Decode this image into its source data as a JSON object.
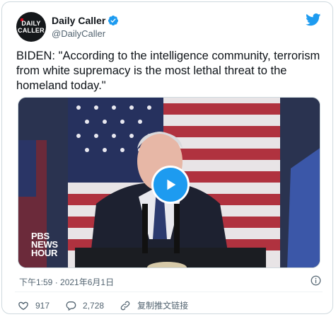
{
  "author": {
    "display_name": "Daily Caller",
    "handle": "@DailyCaller",
    "avatar_line1": "DAILY",
    "avatar_line2": "CALLER"
  },
  "tweet": {
    "text": "BIDEN: \"According to the intelligence community, terrorism from white supremacy is the most lethal threat to the homeland today.\""
  },
  "media": {
    "type": "video",
    "watermark_line1": "PBS",
    "watermark_line2": "NEWS",
    "watermark_line3": "HOUR"
  },
  "timestamp": "下午1:59 · 2021年6月1日",
  "actions": {
    "likes": "917",
    "replies": "2,728",
    "copy_link": "复制推文链接"
  },
  "icons": [
    "verified-badge-icon",
    "twitter-bird-icon",
    "play-icon",
    "info-icon",
    "heart-icon",
    "reply-icon",
    "link-icon"
  ],
  "colors": {
    "accent": "#1d9bf0",
    "text": "#0f1419",
    "muted": "#536471"
  }
}
